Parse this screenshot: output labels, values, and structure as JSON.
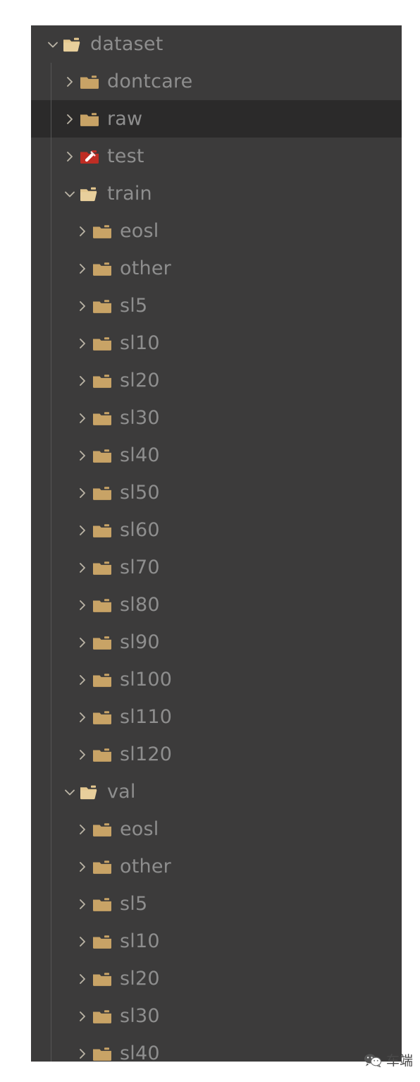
{
  "panel": {
    "name": "file-explorer-tree",
    "background_color": "#3c3b3b",
    "selected_row_color": "#2b2a2a",
    "folder_icon_color": "#c8a366",
    "test_folder_icon_color": "#bf2d24",
    "label_color": "#8e8e8e",
    "chevron_color": "#b9b2a4",
    "indent_guide_color": "#565656"
  },
  "tree": {
    "items": [
      {
        "label": "dataset",
        "depth": 0,
        "expanded": true,
        "icon": "folder-open-icon",
        "selected": false
      },
      {
        "label": "dontcare",
        "depth": 1,
        "expanded": false,
        "icon": "folder-closed-icon",
        "selected": false
      },
      {
        "label": "raw",
        "depth": 1,
        "expanded": false,
        "icon": "folder-closed-icon",
        "selected": true
      },
      {
        "label": "test",
        "depth": 1,
        "expanded": false,
        "icon": "folder-test-icon",
        "selected": false
      },
      {
        "label": "train",
        "depth": 1,
        "expanded": true,
        "icon": "folder-open-icon",
        "selected": false
      },
      {
        "label": "eosl",
        "depth": 2,
        "expanded": false,
        "icon": "folder-closed-icon",
        "selected": false
      },
      {
        "label": "other",
        "depth": 2,
        "expanded": false,
        "icon": "folder-closed-icon",
        "selected": false
      },
      {
        "label": "sl5",
        "depth": 2,
        "expanded": false,
        "icon": "folder-closed-icon",
        "selected": false
      },
      {
        "label": "sl10",
        "depth": 2,
        "expanded": false,
        "icon": "folder-closed-icon",
        "selected": false
      },
      {
        "label": "sl20",
        "depth": 2,
        "expanded": false,
        "icon": "folder-closed-icon",
        "selected": false
      },
      {
        "label": "sl30",
        "depth": 2,
        "expanded": false,
        "icon": "folder-closed-icon",
        "selected": false
      },
      {
        "label": "sl40",
        "depth": 2,
        "expanded": false,
        "icon": "folder-closed-icon",
        "selected": false
      },
      {
        "label": "sl50",
        "depth": 2,
        "expanded": false,
        "icon": "folder-closed-icon",
        "selected": false
      },
      {
        "label": "sl60",
        "depth": 2,
        "expanded": false,
        "icon": "folder-closed-icon",
        "selected": false
      },
      {
        "label": "sl70",
        "depth": 2,
        "expanded": false,
        "icon": "folder-closed-icon",
        "selected": false
      },
      {
        "label": "sl80",
        "depth": 2,
        "expanded": false,
        "icon": "folder-closed-icon",
        "selected": false
      },
      {
        "label": "sl90",
        "depth": 2,
        "expanded": false,
        "icon": "folder-closed-icon",
        "selected": false
      },
      {
        "label": "sl100",
        "depth": 2,
        "expanded": false,
        "icon": "folder-closed-icon",
        "selected": false
      },
      {
        "label": "sl110",
        "depth": 2,
        "expanded": false,
        "icon": "folder-closed-icon",
        "selected": false
      },
      {
        "label": "sl120",
        "depth": 2,
        "expanded": false,
        "icon": "folder-closed-icon",
        "selected": false
      },
      {
        "label": "val",
        "depth": 1,
        "expanded": true,
        "icon": "folder-open-icon",
        "selected": false
      },
      {
        "label": "eosl",
        "depth": 2,
        "expanded": false,
        "icon": "folder-closed-icon",
        "selected": false
      },
      {
        "label": "other",
        "depth": 2,
        "expanded": false,
        "icon": "folder-closed-icon",
        "selected": false
      },
      {
        "label": "sl5",
        "depth": 2,
        "expanded": false,
        "icon": "folder-closed-icon",
        "selected": false
      },
      {
        "label": "sl10",
        "depth": 2,
        "expanded": false,
        "icon": "folder-closed-icon",
        "selected": false
      },
      {
        "label": "sl20",
        "depth": 2,
        "expanded": false,
        "icon": "folder-closed-icon",
        "selected": false
      },
      {
        "label": "sl30",
        "depth": 2,
        "expanded": false,
        "icon": "folder-closed-icon",
        "selected": false
      },
      {
        "label": "sl40",
        "depth": 2,
        "expanded": false,
        "icon": "folder-closed-icon",
        "selected": false
      }
    ]
  },
  "watermark": {
    "icon": "wechat-icon",
    "text": "车端"
  }
}
